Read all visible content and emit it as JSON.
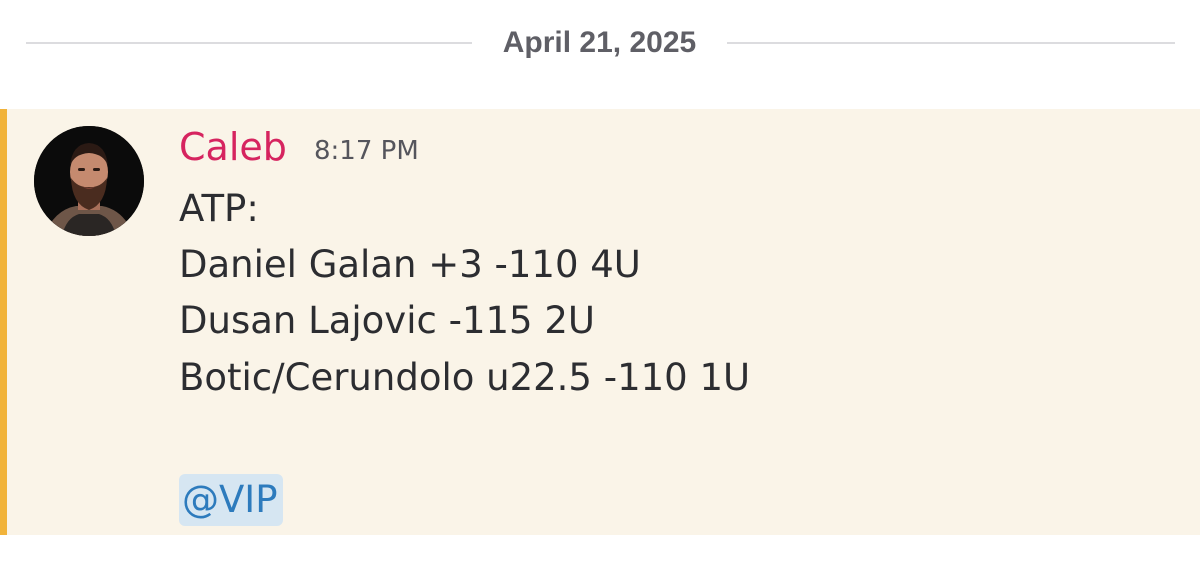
{
  "date_divider": {
    "label": "April 21, 2025"
  },
  "message": {
    "author": "Caleb",
    "author_color": "#d6245f",
    "timestamp": "8:17 PM",
    "highlight_background": "#faf4e8",
    "highlight_accent": "#f1b33a",
    "avatar": "user-photo-avatar",
    "lines": [
      "ATP:",
      "Daniel Galan +3 -110 4U",
      "Dusan Lajovic -115 2U",
      "Botic/Cerundolo u22.5 -110 1U"
    ],
    "mention": "@VIP",
    "mention_color": "#2d7bbd"
  }
}
